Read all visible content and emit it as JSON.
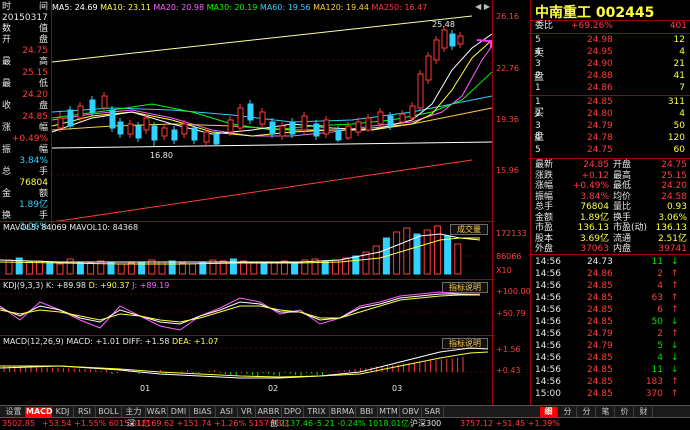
{
  "left_info": {
    "rows": [
      {
        "label": "时",
        "value": "间"
      },
      {
        "label": "20150317",
        "value": ""
      },
      {
        "label": "数",
        "value": "值"
      },
      {
        "label": "开",
        "value": "盘"
      },
      {
        "label": "",
        "value": "24.75"
      },
      {
        "label": "最",
        "value": "高"
      },
      {
        "label": "",
        "value": "25.15"
      },
      {
        "label": "最",
        "value": "低"
      },
      {
        "label": "",
        "value": "24.20"
      },
      {
        "label": "收",
        "value": "盘"
      },
      {
        "label": "",
        "value": "24.85"
      },
      {
        "label": "涨",
        "value": "幅"
      },
      {
        "label": "",
        "value": "+0.49%"
      },
      {
        "label": "振",
        "value": "幅"
      },
      {
        "label": "",
        "value": "3.84%"
      },
      {
        "label": "总",
        "value": "手"
      },
      {
        "label": "",
        "value": "76804"
      },
      {
        "label": "金",
        "value": "额"
      },
      {
        "label": "",
        "value": "1.89亿"
      },
      {
        "label": "换",
        "value": "手"
      },
      {
        "label": "",
        "value": "3.06%"
      }
    ]
  },
  "ma_legend": [
    {
      "text": "MA5: 24.69",
      "color": "#ffffff"
    },
    {
      "text": "MA10: 23.11",
      "color": "#ffff40"
    },
    {
      "text": "MA20: 20.98",
      "color": "#ff60ff"
    },
    {
      "text": "MA30: 20.19",
      "color": "#00ff00"
    },
    {
      "text": "MA60: 19.56",
      "color": "#30d0ff"
    },
    {
      "text": "MA120: 19.44",
      "color": "#ffcc40"
    },
    {
      "text": "MA250: 16.47",
      "color": "#ff3c3c"
    }
  ],
  "price_axis": [
    "26.16",
    "22.76",
    "19.36",
    "15.96"
  ],
  "annotations": {
    "high": "25.48",
    "low": "16.80"
  },
  "volume": {
    "title": "MAVOL5: 84069  MAVOL10: 84368",
    "button": "成交量",
    "axis": [
      "172133",
      "86066",
      "X10"
    ]
  },
  "kdj": {
    "title_prefix": "KDJ(9,3,3)",
    "k": "K: +89.98",
    "d": "D: +90.37",
    "j": "J: +89.19",
    "button": "指标说明",
    "axis": [
      "+100.00",
      "+50.79"
    ]
  },
  "macd": {
    "title_prefix": "MACD(12,26,9)",
    "macd": "MACD: +1.01",
    "diff": "DIFF: +1.58",
    "dea": "DEA: +1.07",
    "button": "指标说明",
    "axis": [
      "+1.56",
      "+0.43"
    ],
    "months": [
      "01",
      "02",
      "03"
    ]
  },
  "stock": {
    "name": "中南重工",
    "code": "002445"
  },
  "weibi": {
    "label": "委比",
    "pct": "+69.26%",
    "diff": "401"
  },
  "sell_orders": [
    {
      "level": "5",
      "price": "24.98",
      "vol": "12"
    },
    {
      "level": "4",
      "price": "24.95",
      "vol": "4"
    },
    {
      "level": "3",
      "price": "24.90",
      "vol": "21"
    },
    {
      "level": "2",
      "price": "24.88",
      "vol": "41"
    },
    {
      "level": "1",
      "price": "24.86",
      "vol": "7"
    }
  ],
  "sell_label": [
    "卖",
    "盘"
  ],
  "buy_orders": [
    {
      "level": "1",
      "price": "24.85",
      "vol": "311"
    },
    {
      "level": "2",
      "price": "24.80",
      "vol": "4"
    },
    {
      "level": "3",
      "price": "24.79",
      "vol": "50"
    },
    {
      "level": "4",
      "price": "24.78",
      "vol": "120"
    },
    {
      "level": "5",
      "price": "24.75",
      "vol": "60"
    }
  ],
  "buy_label": [
    "买",
    "盘"
  ],
  "quote": [
    {
      "l": "最新",
      "lv": "24.85",
      "r": "开盘",
      "rv": "24.75"
    },
    {
      "l": "涨跌",
      "lv": "+0.12",
      "r": "最高",
      "rv": "25.15"
    },
    {
      "l": "涨幅",
      "lv": "+0.49%",
      "r": "最低",
      "rv": "24.20"
    },
    {
      "l": "振幅",
      "lv": "3.84%",
      "r": "均价",
      "rv": "24.58"
    },
    {
      "l": "总手",
      "lv": "76804",
      "r": "量比",
      "rv": "0.93"
    },
    {
      "l": "金额",
      "lv": "1.89亿",
      "r": "换手",
      "rv": "3.06%"
    },
    {
      "l": "市盈",
      "lv": "136.13",
      "r": "市盈(动)",
      "rv": "136.13"
    },
    {
      "l": "股本",
      "lv": "3.69亿",
      "r": "流通",
      "rv": "2.51亿"
    },
    {
      "l": "外盘",
      "lv": "37063",
      "r": "内盘",
      "rv": "39741"
    }
  ],
  "trades": [
    {
      "t": "14:56",
      "p": "24.73",
      "v": "11",
      "d": "down"
    },
    {
      "t": "14:56",
      "p": "24.86",
      "v": "2",
      "d": "up"
    },
    {
      "t": "14:56",
      "p": "24.85",
      "v": "4",
      "d": "up"
    },
    {
      "t": "14:56",
      "p": "24.85",
      "v": "63",
      "d": "up"
    },
    {
      "t": "14:56",
      "p": "24.85",
      "v": "6",
      "d": "up"
    },
    {
      "t": "14:56",
      "p": "24.85",
      "v": "50",
      "d": "down"
    },
    {
      "t": "14:56",
      "p": "24.79",
      "v": "2",
      "d": "up"
    },
    {
      "t": "14:56",
      "p": "24.79",
      "v": "5",
      "d": "down"
    },
    {
      "t": "14:56",
      "p": "24.85",
      "v": "4",
      "d": "down"
    },
    {
      "t": "14:56",
      "p": "24.85",
      "v": "11",
      "d": "down"
    },
    {
      "t": "14:56",
      "p": "24.85",
      "v": "183",
      "d": "up"
    },
    {
      "t": "15:00",
      "p": "24.85",
      "v": "370",
      "d": "up"
    }
  ],
  "tabs": [
    "设置",
    "MACD",
    "KDJ",
    "RSI",
    "BOLL",
    "主力",
    "W&R",
    "DMI",
    "BIAS",
    "ASI",
    "VR",
    "ARBR",
    "DPO",
    "TRIX",
    "BRMA",
    "BBI",
    "MTM",
    "OBV",
    "SAR"
  ],
  "right_tabs": [
    "细",
    "分",
    "分",
    "笔",
    "价",
    "财"
  ],
  "status": [
    {
      "text": "3502.85",
      "color": "#ff3c3c"
    },
    {
      "text": "+53.54 +1.55% 6015.01亿",
      "color": "#ff3c3c"
    },
    {
      "text": "深",
      "color": "#e8e8e8"
    },
    {
      "text": "12169.62 +151.74 +1.26% 5157.93亿",
      "color": "#ff3c3c"
    },
    {
      "text": "创",
      "color": "#e8e8e8"
    },
    {
      "text": "2137.46",
      "color": "#00e000"
    },
    {
      "text": "-5.21 -0.24% 1018.01亿",
      "color": "#00e000"
    },
    {
      "text": "沪深300",
      "color": "#e8e8e8"
    },
    {
      "text": "3757.12 +51.45 +1.39%",
      "color": "#ff3c3c"
    }
  ]
}
